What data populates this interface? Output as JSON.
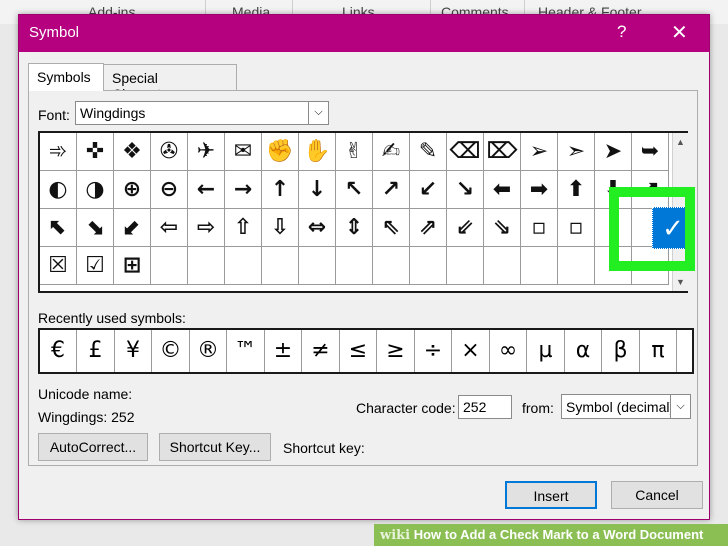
{
  "background_ribbon": {
    "tabs": [
      "Add-ins",
      "Media",
      "Links",
      "Comments",
      "Header & Footer"
    ]
  },
  "dialog": {
    "title": "Symbol",
    "help_glyph": "?",
    "close_glyph": "✕",
    "tabs": [
      {
        "label": "Symbols",
        "active": true
      },
      {
        "label": "Special Characters",
        "active": false
      }
    ],
    "font_label": "Font:",
    "font_value": "Wingdings",
    "dropdown_glyph": "⌵",
    "grid_rows": [
      [
        "➾",
        "✜",
        "❖",
        "✇",
        "✈",
        "✉",
        "✊",
        "✋",
        "✌",
        "✍",
        "✎",
        "⌫",
        "⌦",
        "➢",
        "➣",
        "➤",
        "➥"
      ],
      [
        "◐",
        "◑",
        "⊕",
        "⊖",
        "←",
        "→",
        "↑",
        "↓",
        "↖",
        "↗",
        "↙",
        "↘",
        "⬅",
        "➡",
        "⬆",
        "⬇",
        "⬈"
      ],
      [
        "⬉",
        "⬊",
        "⬋",
        "⇦",
        "⇨",
        "⇧",
        "⇩",
        "⇔",
        "⇕",
        "⇖",
        "⇗",
        "⇙",
        "⇘",
        "▫",
        "▫",
        "",
        ""
      ],
      [
        "☒",
        "☑",
        "⊞",
        "",
        "",
        "",
        "",
        "",
        "",
        "",
        "",
        "",
        "",
        "",
        "",
        "",
        ""
      ]
    ],
    "selected_symbol": "✓",
    "scroll_up": "▲",
    "scroll_down": "▼",
    "recent_label": "Recently used symbols:",
    "recent_symbols": [
      "€",
      "£",
      "¥",
      "©",
      "®",
      "™",
      "±",
      "≠",
      "≤",
      "≥",
      "÷",
      "×",
      "∞",
      "µ",
      "α",
      "β",
      "π"
    ],
    "unicode_name_label": "Unicode name:",
    "unicode_name_value": "Wingdings: 252",
    "character_code_label": "Character code:",
    "character_code_value": "252",
    "from_label": "from:",
    "from_value": "Symbol (decimal)",
    "autocorrect_label": "AutoCorrect...",
    "shortcut_key_button_label": "Shortcut Key...",
    "shortcut_key_label": "Shortcut key:",
    "insert_label": "Insert",
    "cancel_label": "Cancel"
  },
  "watermark": {
    "brand": "wiki",
    "text": "How to Add a Check Mark to a Word Document"
  },
  "colors": {
    "titlebar": "#b5007f",
    "selection": "#0078d7",
    "highlight": "#22ee22",
    "watermark": "#8bbf54"
  }
}
